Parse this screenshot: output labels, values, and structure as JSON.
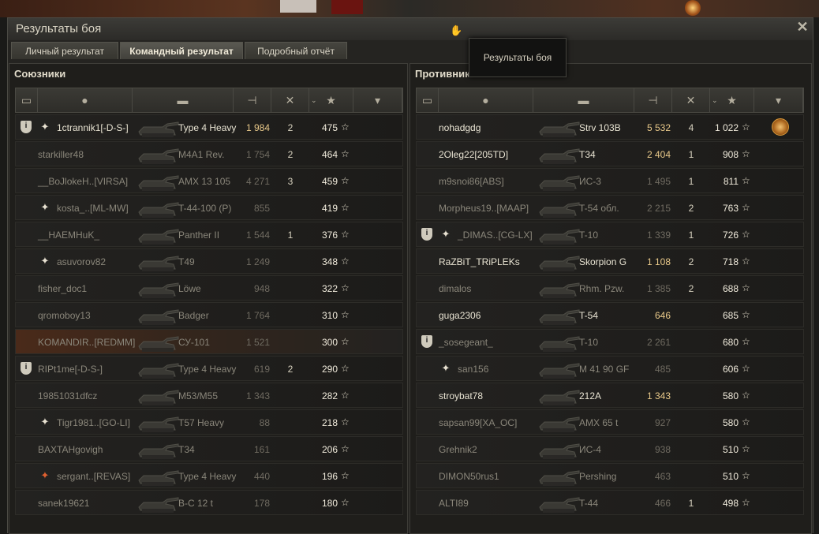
{
  "window": {
    "title": "Результаты боя",
    "close_label": "✕"
  },
  "tabs": [
    {
      "label": "Личный результат",
      "active": false
    },
    {
      "label": "Командный результат",
      "active": true
    },
    {
      "label": "Подробный отчёт",
      "active": false
    }
  ],
  "tooltip": {
    "text": "Результаты боя"
  },
  "allies": {
    "title": "Союзники",
    "rows": [
      {
        "clan": true,
        "platoon": "white",
        "player": "1ctrannik1[-D-S-]",
        "vehicle": "Type 4 Heavy",
        "damage": "1 984",
        "kills": "2",
        "xp": "475",
        "alive": true
      },
      {
        "clan": false,
        "platoon": "",
        "player": "starkiller48",
        "vehicle": "M4A1 Rev.",
        "damage": "1 754",
        "kills": "2",
        "xp": "464",
        "alive": false
      },
      {
        "clan": false,
        "platoon": "",
        "player": "__BoJlokeH..[VIRSA]",
        "vehicle": "AMX 13 105",
        "damage": "4 271",
        "kills": "3",
        "xp": "459",
        "alive": false
      },
      {
        "clan": false,
        "platoon": "white",
        "player": "kosta_..[ML-MW]",
        "vehicle": "T-44-100 (P)",
        "damage": "855",
        "kills": "",
        "xp": "419",
        "alive": false
      },
      {
        "clan": false,
        "platoon": "",
        "player": "__HAEMHuK_",
        "vehicle": "Panther II",
        "damage": "1 544",
        "kills": "1",
        "xp": "376",
        "alive": false
      },
      {
        "clan": false,
        "platoon": "white",
        "player": "asuvorov82",
        "vehicle": "T49",
        "damage": "1 249",
        "kills": "",
        "xp": "348",
        "alive": false
      },
      {
        "clan": false,
        "platoon": "",
        "player": "fisher_doc1",
        "vehicle": "Löwe",
        "damage": "948",
        "kills": "",
        "xp": "322",
        "alive": false
      },
      {
        "clan": false,
        "platoon": "",
        "player": "qromoboy13",
        "vehicle": "Badger",
        "damage": "1 764",
        "kills": "",
        "xp": "310",
        "alive": false
      },
      {
        "clan": false,
        "platoon": "",
        "player": "KOMANDIR..[REDMM]",
        "vehicle": "СУ-101",
        "damage": "1 521",
        "kills": "",
        "xp": "300",
        "alive": false,
        "highlight": true
      },
      {
        "clan": true,
        "platoon": "",
        "player": "RIPt1me[-D-S-]",
        "vehicle": "Type 4 Heavy",
        "damage": "619",
        "kills": "2",
        "xp": "290",
        "alive": false
      },
      {
        "clan": false,
        "platoon": "",
        "player": "19851031dfcz",
        "vehicle": "M53/M55",
        "damage": "1 343",
        "kills": "",
        "xp": "282",
        "alive": false
      },
      {
        "clan": false,
        "platoon": "white",
        "player": "Tigr1981..[GO-LI]",
        "vehicle": "T57 Heavy",
        "damage": "88",
        "kills": "",
        "xp": "218",
        "alive": false
      },
      {
        "clan": false,
        "platoon": "",
        "player": "BAXTAHgovigh",
        "vehicle": "T34",
        "damage": "161",
        "kills": "",
        "xp": "206",
        "alive": false
      },
      {
        "clan": false,
        "platoon": "red",
        "player": "sergant..[REVAS]",
        "vehicle": "Type 4 Heavy",
        "damage": "440",
        "kills": "",
        "xp": "196",
        "alive": false
      },
      {
        "clan": false,
        "platoon": "",
        "player": "sanek19621",
        "vehicle": "B-C 12 t",
        "damage": "178",
        "kills": "",
        "xp": "180",
        "alive": false
      }
    ]
  },
  "enemies": {
    "title": "Противники",
    "rows": [
      {
        "clan": false,
        "platoon": "",
        "player": "nohadgdg",
        "vehicle": "Strv 103B",
        "damage": "5 532",
        "kills": "4",
        "xp": "1 022",
        "alive": true,
        "medal": true
      },
      {
        "clan": false,
        "platoon": "",
        "player": "2Oleg22[205TD]",
        "vehicle": "T34",
        "damage": "2 404",
        "kills": "1",
        "xp": "908",
        "alive": true
      },
      {
        "clan": false,
        "platoon": "",
        "player": "m9snoi86[ABS]",
        "vehicle": "ИС-3",
        "damage": "1 495",
        "kills": "1",
        "xp": "811",
        "alive": false
      },
      {
        "clan": false,
        "platoon": "",
        "player": "Morpheus19..[MAAP]",
        "vehicle": "T-54 обл.",
        "damage": "2 215",
        "kills": "2",
        "xp": "763",
        "alive": false
      },
      {
        "clan": true,
        "platoon": "white",
        "player": "_DIMAS..[CG-LX]",
        "vehicle": "T-10",
        "damage": "1 339",
        "kills": "1",
        "xp": "726",
        "alive": false
      },
      {
        "clan": false,
        "platoon": "",
        "player": "RaZBiT_TRiPLEKs",
        "vehicle": "Skorpion G",
        "damage": "1 108",
        "kills": "2",
        "xp": "718",
        "alive": true
      },
      {
        "clan": false,
        "platoon": "",
        "player": "dimalos",
        "vehicle": "Rhm. Pzw.",
        "damage": "1 385",
        "kills": "2",
        "xp": "688",
        "alive": false
      },
      {
        "clan": false,
        "platoon": "",
        "player": "guga2306",
        "vehicle": "T-54",
        "damage": "646",
        "kills": "",
        "xp": "685",
        "alive": true
      },
      {
        "clan": true,
        "platoon": "",
        "player": "_sosegeant_",
        "vehicle": "T-10",
        "damage": "2 261",
        "kills": "",
        "xp": "680",
        "alive": false
      },
      {
        "clan": false,
        "platoon": "white",
        "player": "san156",
        "vehicle": "M 41 90 GF",
        "damage": "485",
        "kills": "",
        "xp": "606",
        "alive": false
      },
      {
        "clan": false,
        "platoon": "",
        "player": "stroybat78",
        "vehicle": "212A",
        "damage": "1 343",
        "kills": "",
        "xp": "580",
        "alive": true
      },
      {
        "clan": false,
        "platoon": "",
        "player": "sapsan99[XA_OC]",
        "vehicle": "AMX 65 t",
        "damage": "927",
        "kills": "",
        "xp": "580",
        "alive": false
      },
      {
        "clan": false,
        "platoon": "",
        "player": "Grehnik2",
        "vehicle": "ИС-4",
        "damage": "938",
        "kills": "",
        "xp": "510",
        "alive": false
      },
      {
        "clan": false,
        "platoon": "",
        "player": "DIMON50rus1",
        "vehicle": "Pershing",
        "damage": "463",
        "kills": "",
        "xp": "510",
        "alive": false
      },
      {
        "clan": false,
        "platoon": "",
        "player": "ALTI89",
        "vehicle": "T-44",
        "damage": "466",
        "kills": "1",
        "xp": "498",
        "alive": false
      }
    ]
  },
  "icons": {
    "squad": "squad-icon",
    "player": "player-icon",
    "tank": "tank-icon",
    "damage": "damage-icon",
    "kills": "kills-icon",
    "xp": "star-icon",
    "medals": "medal-icon"
  },
  "colors": {
    "alive_text": "#e8e3d2",
    "dead_text": "#8a867a",
    "damage_alive": "#e8c98a",
    "highlight_row": "#4a2a1a"
  }
}
